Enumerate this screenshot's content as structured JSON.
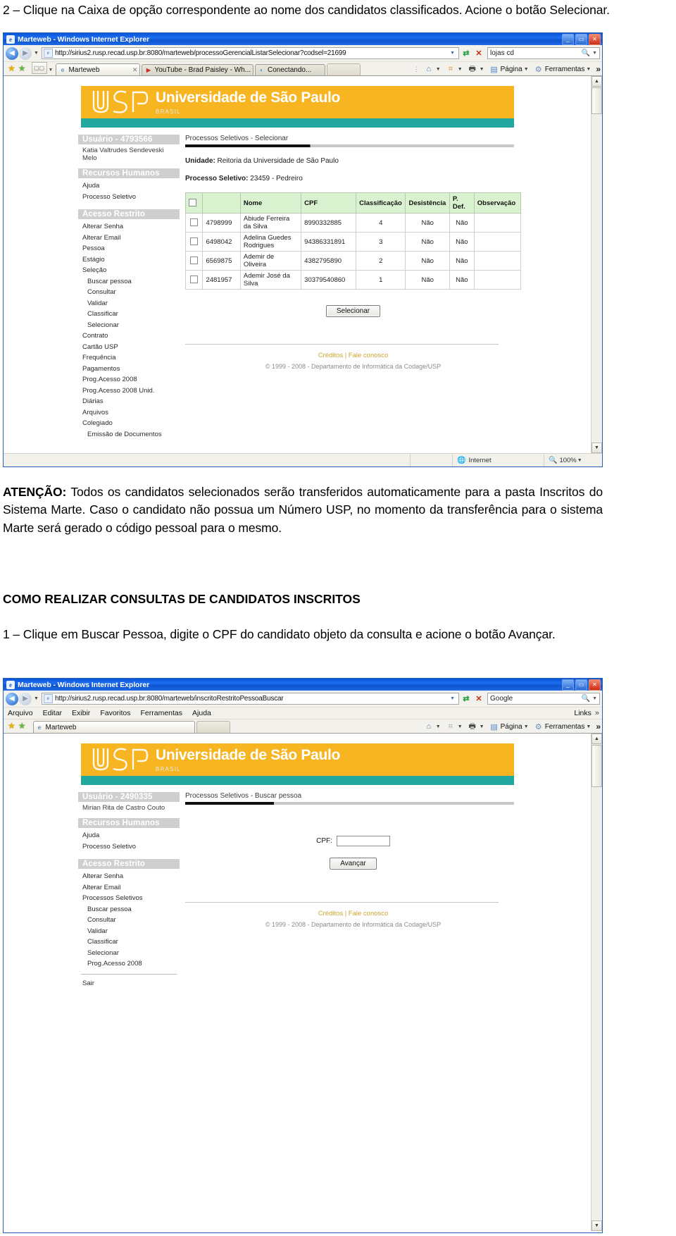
{
  "document": {
    "intro_step": "2 – Clique na Caixa de opção correspondente ao nome dos  candidatos classificados. Acione o botão Selecionar.",
    "attention_label": "ATENÇÃO:",
    "attention_text": " Todos os candidatos selecionados serão transferidos automaticamente para a pasta Inscritos do Sistema Marte. Caso o candidato não possua um Número USP, no momento da transferência para o sistema Marte será gerado o código pessoal para o mesmo.",
    "section_heading": "COMO REALIZAR CONSULTAS DE CANDIDATOS INSCRITOS",
    "step_one": "1 – Clique em Buscar Pessoa, digite o CPF do candidato objeto da consulta e acione o botão Avançar."
  },
  "shot1": {
    "window_title": "Marteweb - Windows Internet Explorer",
    "address": {
      "url": "http://sirius2.rusp.recad.usp.br:8080/marteweb/processoGerencialListarSelecionar?codsel=21699",
      "search_value": "lojas cd"
    },
    "tabs": [
      {
        "label": "Marteweb",
        "icon": "ie-page-icon"
      },
      {
        "label": "YouTube - Brad Paisley - Wh...",
        "icon": "youtube-icon"
      },
      {
        "label": "Conectando...",
        "icon": "loading-icon"
      }
    ],
    "toolbar": {
      "page_label": "Página",
      "tools_label": "Ferramentas"
    },
    "page": {
      "banner_title": "Universidade de São Paulo",
      "banner_sub": "BRASIL",
      "user_header": "Usuário - 4793566",
      "user_name": "Katia Valtrudes Sendeveski Melo",
      "group_rh": "Recursos Humanos",
      "rh_links": [
        "Ajuda",
        "Processo Seletivo"
      ],
      "group_restrito": "Acesso Restrito",
      "restrito_links": [
        {
          "label": "Alterar Senha",
          "indent": false
        },
        {
          "label": "Alterar Email",
          "indent": false
        },
        {
          "label": "Pessoa",
          "indent": false
        },
        {
          "label": "Estágio",
          "indent": false
        },
        {
          "label": "Seleção",
          "indent": false
        },
        {
          "label": "Buscar pessoa",
          "indent": true
        },
        {
          "label": "Consultar",
          "indent": true
        },
        {
          "label": "Validar",
          "indent": true
        },
        {
          "label": "Classificar",
          "indent": true
        },
        {
          "label": "Selecionar",
          "indent": true
        },
        {
          "label": "Contrato",
          "indent": false
        },
        {
          "label": "Cartão USP",
          "indent": false
        },
        {
          "label": "Frequência",
          "indent": false
        },
        {
          "label": "Pagamentos",
          "indent": false
        },
        {
          "label": "Prog.Acesso 2008",
          "indent": false
        },
        {
          "label": "Prog.Acesso 2008 Unid.",
          "indent": false
        },
        {
          "label": "Diárias",
          "indent": false
        },
        {
          "label": "Arquivos",
          "indent": false
        },
        {
          "label": "Colegiado",
          "indent": false
        },
        {
          "label": "Emissão de Documentos",
          "indent": false
        }
      ],
      "breadcrumb": "Processos Seletivos - Selecionar",
      "unidade_label": "Unidade:",
      "unidade_value": " Reitoria da Universidade de São Paulo",
      "processo_label": "Processo Seletivo:",
      "processo_value": " 23459 - Pedreiro",
      "table_headers": [
        "",
        "",
        "Nome",
        "CPF",
        "Classificação",
        "Desistência",
        "P. Def.",
        "Observação"
      ],
      "table_rows": [
        {
          "cod": "4798999",
          "nome": "Abiude Ferreira da Silva",
          "cpf": "8990332885",
          "classificacao": "4",
          "desistencia": "Não",
          "pdef": "Não",
          "obs": ""
        },
        {
          "cod": "6498042",
          "nome": "Adelina Guedes Rodrigues",
          "cpf": "94386331891",
          "classificacao": "3",
          "desistencia": "Não",
          "pdef": "Não",
          "obs": ""
        },
        {
          "cod": "6569875",
          "nome": "Ademir de Oliveira",
          "cpf": "4382795890",
          "classificacao": "2",
          "desistencia": "Não",
          "pdef": "Não",
          "obs": ""
        },
        {
          "cod": "2481957",
          "nome": "Ademir José da Silva",
          "cpf": "30379540860",
          "classificacao": "1",
          "desistencia": "Não",
          "pdef": "Não",
          "obs": ""
        }
      ],
      "submit_button": "Selecionar",
      "footer_links": "Créditos | Fale conosco",
      "footer_copy": "© 1999 - 2008 - Departamento de Informática da Codage/USP"
    },
    "status": {
      "zone": "Internet",
      "zoom": "100%"
    }
  },
  "shot2": {
    "window_title": "Marteweb - Windows Internet Explorer",
    "address": {
      "url": "http://sirius2.rusp.recad.usp.br:8080/marteweb/inscritoRestritoPessoaBuscar",
      "search_value": "Google"
    },
    "menus": [
      "Arquivo",
      "Editar",
      "Exibir",
      "Favoritos",
      "Ferramentas",
      "Ajuda"
    ],
    "menu_links_label": "Links",
    "tabs": [
      {
        "label": "Marteweb",
        "icon": "ie-page-icon"
      }
    ],
    "toolbar": {
      "page_label": "Página",
      "tools_label": "Ferramentas"
    },
    "page": {
      "banner_title": "Universidade de São Paulo",
      "banner_sub": "BRASIL",
      "user_header": "Usuário - 2490335",
      "user_name": "Mirian Rita de Castro Couto",
      "group_rh": "Recursos Humanos",
      "rh_links": [
        "Ajuda",
        "Processo Seletivo"
      ],
      "group_restrito": "Acesso Restrito",
      "restrito_links": [
        {
          "label": "Alterar Senha",
          "indent": false
        },
        {
          "label": "Alterar Email",
          "indent": false
        },
        {
          "label": "Processos Seletivos",
          "indent": false
        },
        {
          "label": "Buscar pessoa",
          "indent": true
        },
        {
          "label": "Consultar",
          "indent": true
        },
        {
          "label": "Validar",
          "indent": true
        },
        {
          "label": "Classificar",
          "indent": true
        },
        {
          "label": "Selecionar",
          "indent": true
        },
        {
          "label": "Prog.Acesso 2008",
          "indent": true
        }
      ],
      "exit_link": "Sair",
      "breadcrumb": "Processos Seletivos - Buscar pessoa",
      "cpf_label": "CPF:",
      "cpf_value": "",
      "submit_button": "Avançar",
      "footer_links": "Créditos | Fale conosco",
      "footer_copy": "© 1999 - 2008 - Departamento de Informática da Codage/USP"
    }
  }
}
